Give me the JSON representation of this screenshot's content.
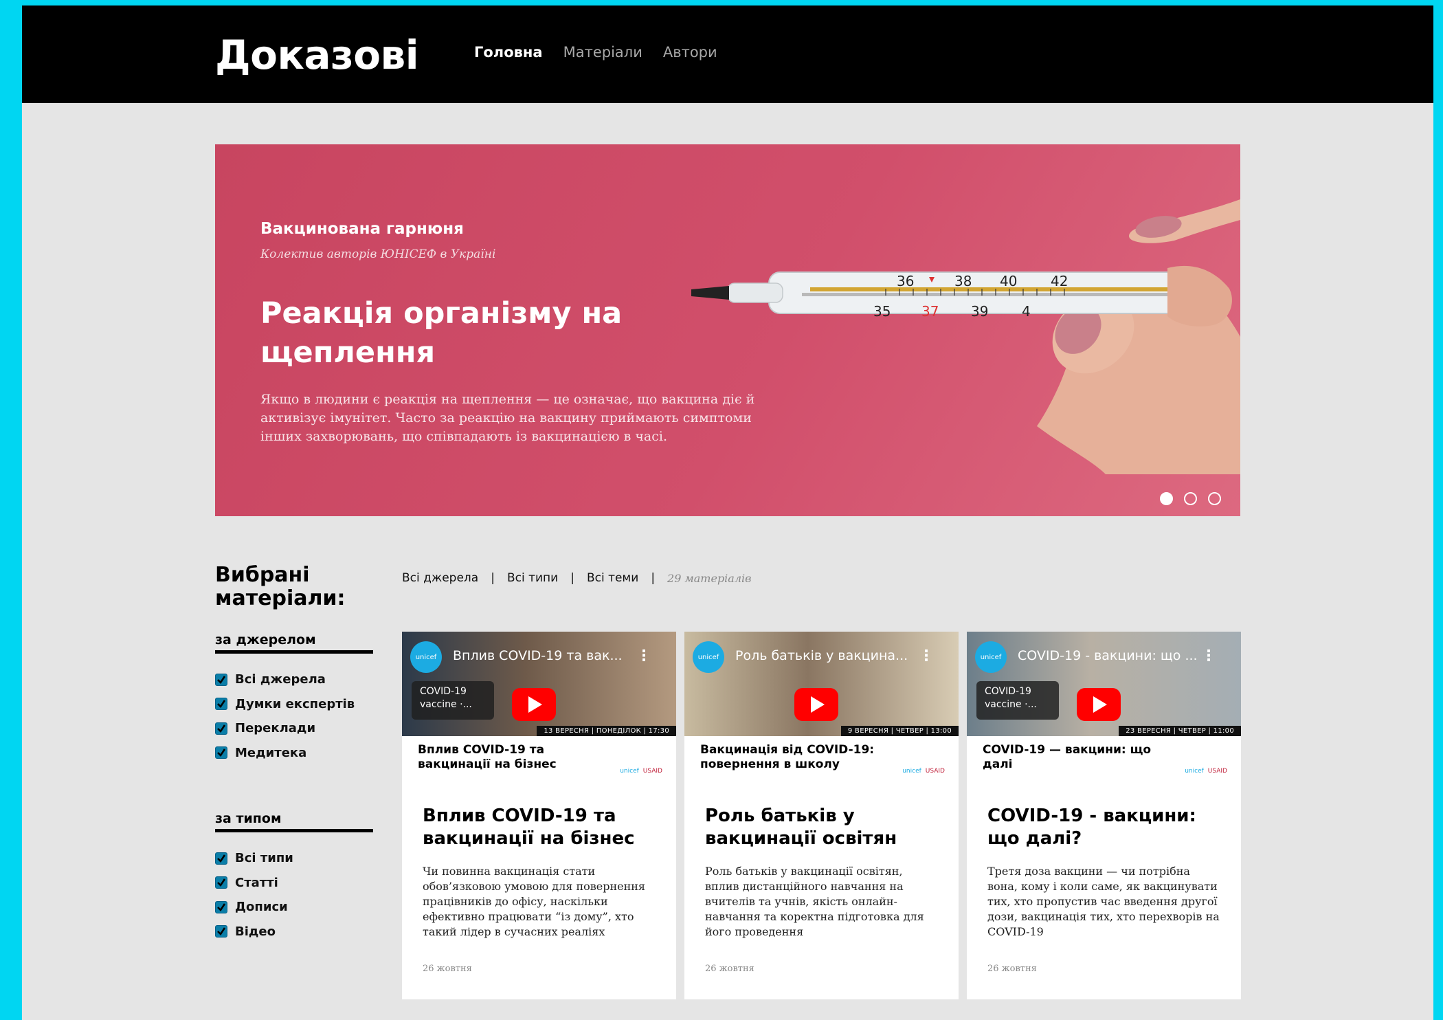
{
  "header": {
    "logo": "Доказові",
    "nav": [
      "Головна",
      "Матеріали",
      "Автори"
    ]
  },
  "hero": {
    "kicker": "Вакцинована гарнюня",
    "authors": "Колектив авторів ЮНІСЕФ в Україні",
    "title": "Реакція організму на щеплення",
    "description": "Якщо в людини є реакція на щеплення — це означає, що вакцина діє й активізує імунітет. Часто за реакцію на вакцину приймають симптоми інших захворювань, що співпадають із вакцинацією в часі.",
    "slide_count": 3,
    "active_slide": 1,
    "thermometer_marks_top": [
      "36",
      "38",
      "40",
      "42"
    ],
    "thermometer_marks_bottom": [
      "35",
      "37",
      "39",
      "4"
    ]
  },
  "sidebar": {
    "title": "Вибрані матеріали:",
    "groups": [
      {
        "title": "за джерелом",
        "items": [
          {
            "label": "Всі джерела",
            "checked": true
          },
          {
            "label": "Думки експертів",
            "checked": true
          },
          {
            "label": "Переклади",
            "checked": true
          },
          {
            "label": "Медитека",
            "checked": true
          }
        ]
      },
      {
        "title": "за типом",
        "items": [
          {
            "label": "Всі типи",
            "checked": true
          },
          {
            "label": "Статті",
            "checked": true
          },
          {
            "label": "Дописи",
            "checked": true
          },
          {
            "label": "Відео",
            "checked": true
          }
        ]
      }
    ]
  },
  "filters": {
    "sources": "Всі джерела",
    "types": "Всі типи",
    "topics": "Всі теми",
    "count": "29 матеріалів"
  },
  "cards": [
    {
      "video_title": "Вплив COVID-19 та вак...",
      "pill": "COVID-19 vaccine ·...",
      "date_band": "13 ВЕРЕСНЯ | ПОНЕДІЛОК | 17:30",
      "caption": "Вплив COVID-19 та вакцинації на бізнес",
      "title": "Вплив COVID-19 та вакцинації на бізнес",
      "description": "Чи повинна вакцинація стати обов’язковою умовою для повернення працівників до офісу, наскільки ефективно працювати “із дому”, хто такий лідер в сучасних реаліях",
      "date": "26 жовтня",
      "thumb_colors": [
        "#2c3a4a",
        "#6e5a4a",
        "#b49a80"
      ]
    },
    {
      "video_title": "Роль батьків у вакцина...",
      "pill": "",
      "date_band": "9 ВЕРЕСНЯ | ЧЕТВЕР | 13:00",
      "caption": "Вакцинація від COVID-19: повернення в школу",
      "title": "Роль батьків у вакцинації освітян",
      "description": "Роль батьків у вакцинації освітян, вплив дистанційного навчання на вчителів та учнів, якість онлайн-навчання та коректна підготовка для його проведення",
      "date": "26 жовтня",
      "thumb_colors": [
        "#c8bba0",
        "#8a7662",
        "#d8ccb4"
      ]
    },
    {
      "video_title": "COVID-19 - вакцини: що ...",
      "pill": "COVID-19 vaccine ·...",
      "date_band": "23 ВЕРЕСНЯ | ЧЕТВЕР | 11:00",
      "caption": "COVID-19 — вакцини: що далі",
      "title": "COVID-19 - вакцини: що далі?",
      "description": "Третя доза вакцини — чи потрібна вона, кому і коли саме, як вакцинувати тих, хто пропустив час введення другої дози, вакцинація тих, хто перехворів на COVID-19",
      "date": "26 жовтня",
      "thumb_colors": [
        "#6c7e8a",
        "#b8b0a4",
        "#a4aeb4"
      ]
    }
  ],
  "thumb_logos": {
    "unicef": "unicef",
    "usaid": "USAID"
  }
}
